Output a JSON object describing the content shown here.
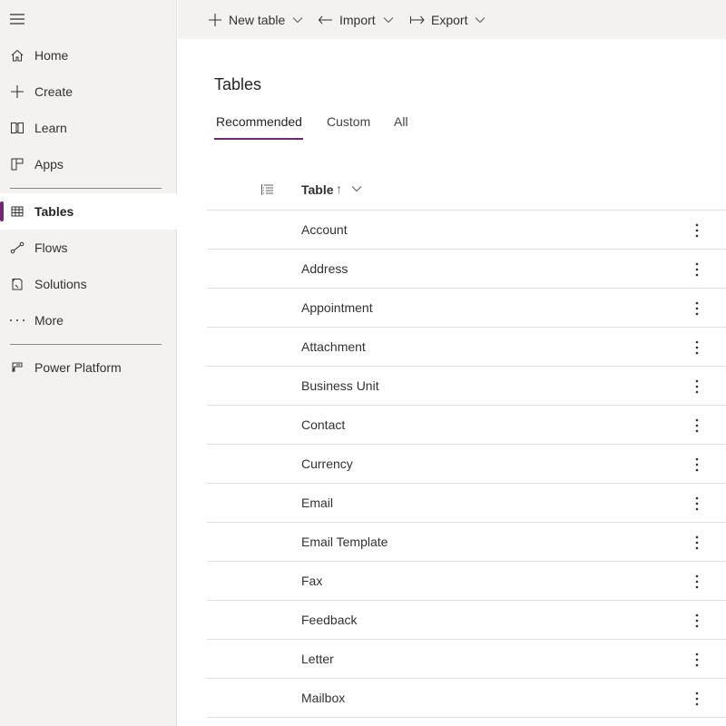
{
  "sidebar": {
    "items": [
      {
        "label": "Home",
        "icon": "home-icon"
      },
      {
        "label": "Create",
        "icon": "plus-icon"
      },
      {
        "label": "Learn",
        "icon": "book-icon"
      },
      {
        "label": "Apps",
        "icon": "apps-icon"
      },
      {
        "label": "Tables",
        "icon": "table-icon",
        "active": true
      },
      {
        "label": "Flows",
        "icon": "flow-icon"
      },
      {
        "label": "Solutions",
        "icon": "solutions-icon"
      },
      {
        "label": "More",
        "icon": "more-icon"
      },
      {
        "label": "Power Platform",
        "icon": "power-platform-icon"
      }
    ],
    "accent": "#742774"
  },
  "commandbar": {
    "new_table": "New table",
    "import": "Import",
    "export": "Export"
  },
  "main": {
    "title": "Tables",
    "tabs": [
      {
        "label": "Recommended",
        "active": true
      },
      {
        "label": "Custom"
      },
      {
        "label": "All"
      }
    ],
    "grid": {
      "column_header": "Table",
      "sort_indicator": "↑",
      "rows": [
        "Account",
        "Address",
        "Appointment",
        "Attachment",
        "Business Unit",
        "Contact",
        "Currency",
        "Email",
        "Email Template",
        "Fax",
        "Feedback",
        "Letter",
        "Mailbox"
      ]
    }
  }
}
